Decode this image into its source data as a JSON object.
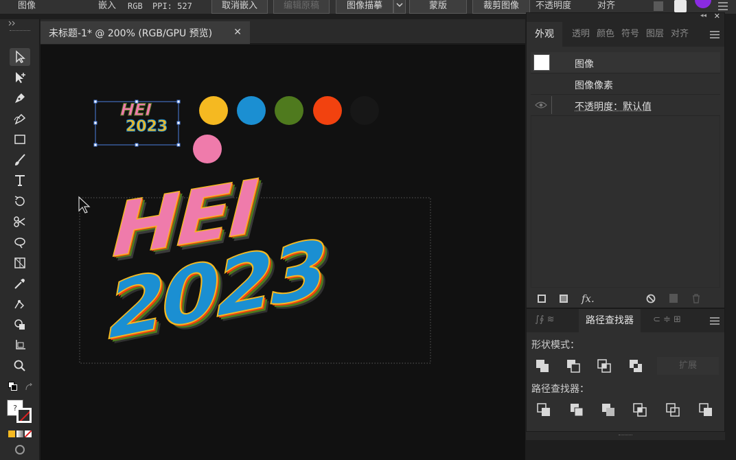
{
  "topbar": {
    "image_label": "图像",
    "embed_label": "嵌入",
    "color_mode": "RGB",
    "ppi": "PPI: 527",
    "unembed_button": "取消嵌入",
    "edit_original_button": "编辑原稿",
    "image_trace_button": "图像描摹",
    "mask_button": "蒙版",
    "crop_image_button": "裁剪图像",
    "opacity_label": "不透明度",
    "align_label": "对齐"
  },
  "document": {
    "tab_title": "未标题-1* @ 200% (RGB/GPU 预览)",
    "artwork_line1": "HEI",
    "artwork_line2": "2023",
    "palette_colors": [
      "#f5b921",
      "#1b8fd2",
      "#4f7a1e",
      "#f2420f",
      "#171717",
      "#ef7bab"
    ]
  },
  "appearance_panel": {
    "tabs": [
      "外观",
      "透明",
      "颜色",
      "符号",
      "图层",
      "对齐"
    ],
    "item_type": "图像",
    "row_pixels": "图像像素",
    "row_opacity": "不透明度：默认值",
    "fx_label": "fx."
  },
  "pathfinder_panel": {
    "tab_title": "路径查找器",
    "shape_modes_label": "形状模式：",
    "expand_button": "扩展",
    "pathfinders_label": "路径查找器："
  },
  "tools": {
    "color_fill": "#ffffff",
    "color_stroke": "#e02020"
  }
}
